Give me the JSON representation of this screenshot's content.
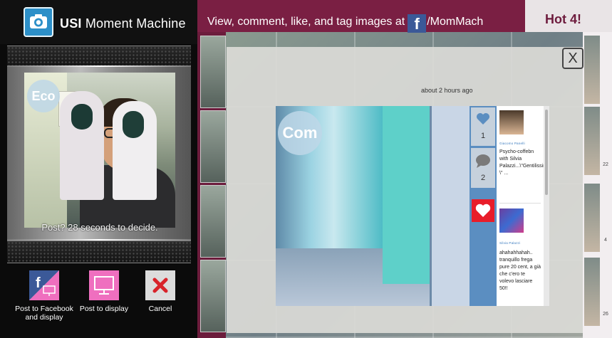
{
  "app": {
    "title_bold": "USI",
    "title_rest": "Moment Machine"
  },
  "preview": {
    "badge": "Eco",
    "timer_text": "Post? 28 seconds to decide."
  },
  "actions": {
    "facebook_label": "Post to Facebook and display",
    "display_label": "Post to display",
    "cancel_label": "Cancel"
  },
  "banner": {
    "text_before": "View, comment, like, and tag images at",
    "fb_letter": "f",
    "text_after": "/MomMach"
  },
  "hot": {
    "label": "Hot 4!"
  },
  "overlay": {
    "close_label": "X",
    "timestamp": "about 2 hours ago",
    "photo_badge": "Com",
    "likes": "1",
    "comments_count": "2",
    "comments": [
      {
        "author": "Giacomo Panelli",
        "text": "Psycho-coffebn with Silvia Palazzi...\\\"Gentilissima \\\" ..."
      },
      {
        "author": "Silvia Palazzi",
        "text": "ahahahhahah.. tranquillo frega pure 20 cent, a già che c'ero te volevo lasciare 50!!"
      }
    ]
  },
  "right_counts": [
    "22",
    "4",
    "26"
  ],
  "colors": {
    "banner": "#7a1f43",
    "heart": "#e81d2a",
    "facebook": "#3b5998",
    "display_pink": "#ef6fbf"
  }
}
